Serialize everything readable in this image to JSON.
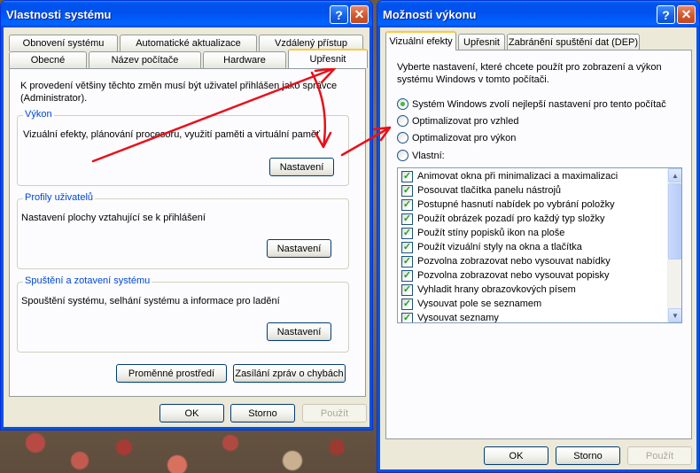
{
  "left_window": {
    "title": "Vlastnosti systému",
    "tabs_row1": [
      "Obnovení systému",
      "Automatické aktualizace",
      "Vzdálený přístup"
    ],
    "tabs_row2": [
      "Obecné",
      "Název počítače",
      "Hardware",
      "Upřesnit"
    ],
    "admin_note": "K provedení většiny těchto změn musí být uživatel přihlášen jako správce (Administrator).",
    "group_performance": {
      "title": "Výkon",
      "text": "Vizuální efekty, plánování procesoru, využití paměti a virtuální paměť",
      "button": "Nastavení"
    },
    "group_profiles": {
      "title": "Profily uživatelů",
      "text": "Nastavení plochy vztahující se k přihlášení",
      "button": "Nastavení"
    },
    "group_startup": {
      "title": "Spuštění a zotavení systému",
      "text": "Spouštění systému, selhání systému a informace pro ladění",
      "button": "Nastavení"
    },
    "env_button": "Proměnné prostředí",
    "error_button": "Zasílání zpráv o chybách",
    "ok": "OK",
    "cancel": "Storno",
    "apply": "Použít"
  },
  "right_window": {
    "title": "Možnosti výkonu",
    "tabs": [
      "Vizuální efekty",
      "Upřesnit",
      "Zabránění spuštění dat (DEP)"
    ],
    "intro": "Vyberte nastavení, které chcete použít pro zobrazení a výkon systému Windows v tomto počítači.",
    "options": [
      {
        "label": "Systém Windows zvolí nejlepší nastavení pro tento počítač",
        "selected": true
      },
      {
        "label": "Optimalizovat pro vzhled",
        "selected": false
      },
      {
        "label": "Optimalizovat pro výkon",
        "selected": false
      },
      {
        "label": "Vlastní:",
        "selected": false
      }
    ],
    "effects": [
      "Animovat okna při minimalizaci a maximalizaci",
      "Posouvat tlačítka panelu nástrojů",
      "Postupné hasnutí nabídek po vybrání položky",
      "Použít obrázek pozadí pro každý typ složky",
      "Použít stíny popisků ikon na ploše",
      "Použít vizuální styly na okna a tlačítka",
      "Pozvolna zobrazovat nebo vysouvat nabídky",
      "Pozvolna zobrazovat nebo vysouvat popisky",
      "Vyhladit hrany obrazovkových písem",
      "Vysouvat pole se seznamem",
      "Vysouvat seznamy"
    ],
    "ok": "OK",
    "cancel": "Storno",
    "apply": "Použít"
  },
  "titlebar_help": "?",
  "titlebar_close": "✕",
  "checkmark": "✓",
  "scroll_up": "▲",
  "scroll_down": "▼",
  "colors": {
    "annotation_arrow": "#e8101a",
    "title_blue": "#0054e3",
    "group_title": "#0046d5"
  }
}
